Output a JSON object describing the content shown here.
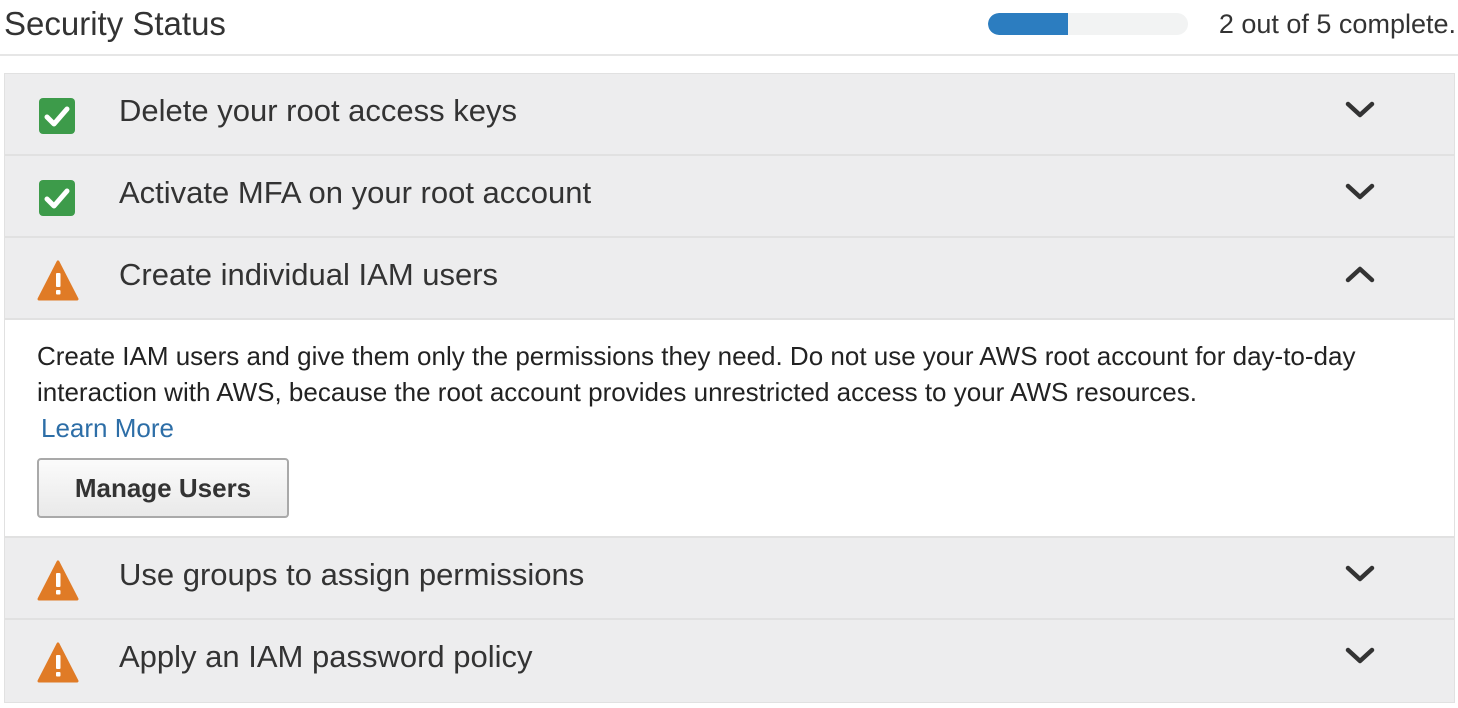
{
  "header": {
    "title": "Security Status",
    "progress_fraction": 0.4,
    "progress_color": "#2c7dc0",
    "progress_text": "2 out of 5 complete."
  },
  "items": [
    {
      "label": "Delete your root access keys",
      "status": "complete",
      "icon": "check-icon",
      "expanded": false
    },
    {
      "label": "Activate MFA on your root account",
      "status": "complete",
      "icon": "check-icon",
      "expanded": false
    },
    {
      "label": "Create individual IAM users",
      "status": "warning",
      "icon": "warning-icon",
      "expanded": true
    },
    {
      "label": "Use groups to assign permissions",
      "status": "warning",
      "icon": "warning-icon",
      "expanded": false
    },
    {
      "label": "Apply an IAM password policy",
      "status": "warning",
      "icon": "warning-icon",
      "expanded": false
    }
  ],
  "expanded_panel": {
    "description": "Create IAM users and give them only the permissions they need. Do not use your AWS root account for day-to-day interaction with AWS, because the root account provides unrestricted access to your AWS resources.",
    "learn_more": "Learn More",
    "button_label": "Manage Users"
  },
  "colors": {
    "complete": "#3d9b4a",
    "warning": "#e07b26",
    "link": "#2d6ea7"
  }
}
